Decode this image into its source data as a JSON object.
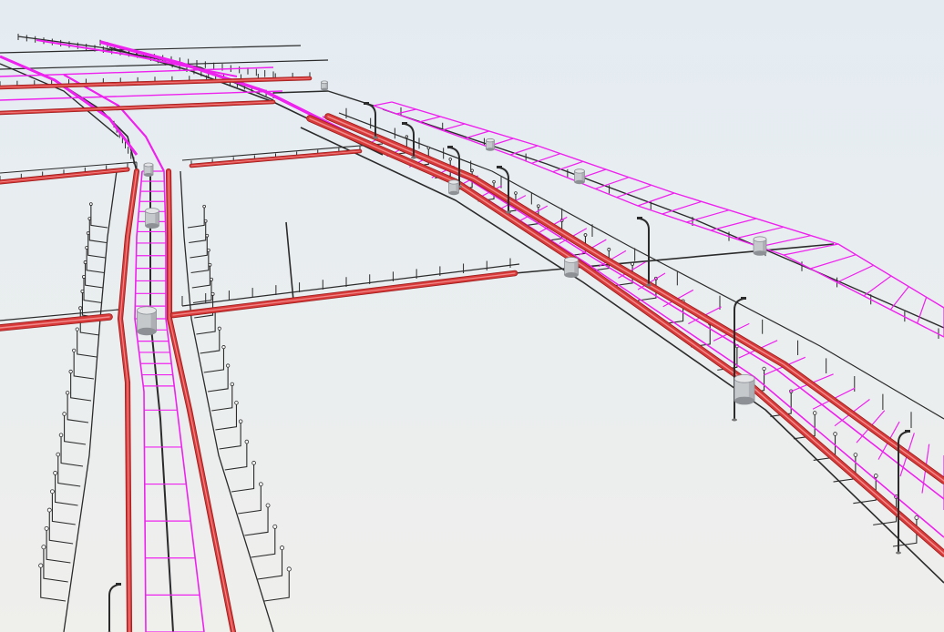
{
  "scene": {
    "kind": "3D utility network model (no visible text)",
    "colors": {
      "sky_top": "#e4ecf2",
      "sky_bottom": "#efefec",
      "pipe": "#d83a3a",
      "pipe_dark": "#9b1c1c",
      "pipe_light": "#f08a8a",
      "cable": "#ee22ee",
      "wire": "#2b2b2b",
      "chamber": "#c6c9cc",
      "chamber_shade": "#8d9196"
    },
    "icons": [
      "manhole-chamber-icon",
      "street-light-pole-icon"
    ]
  }
}
